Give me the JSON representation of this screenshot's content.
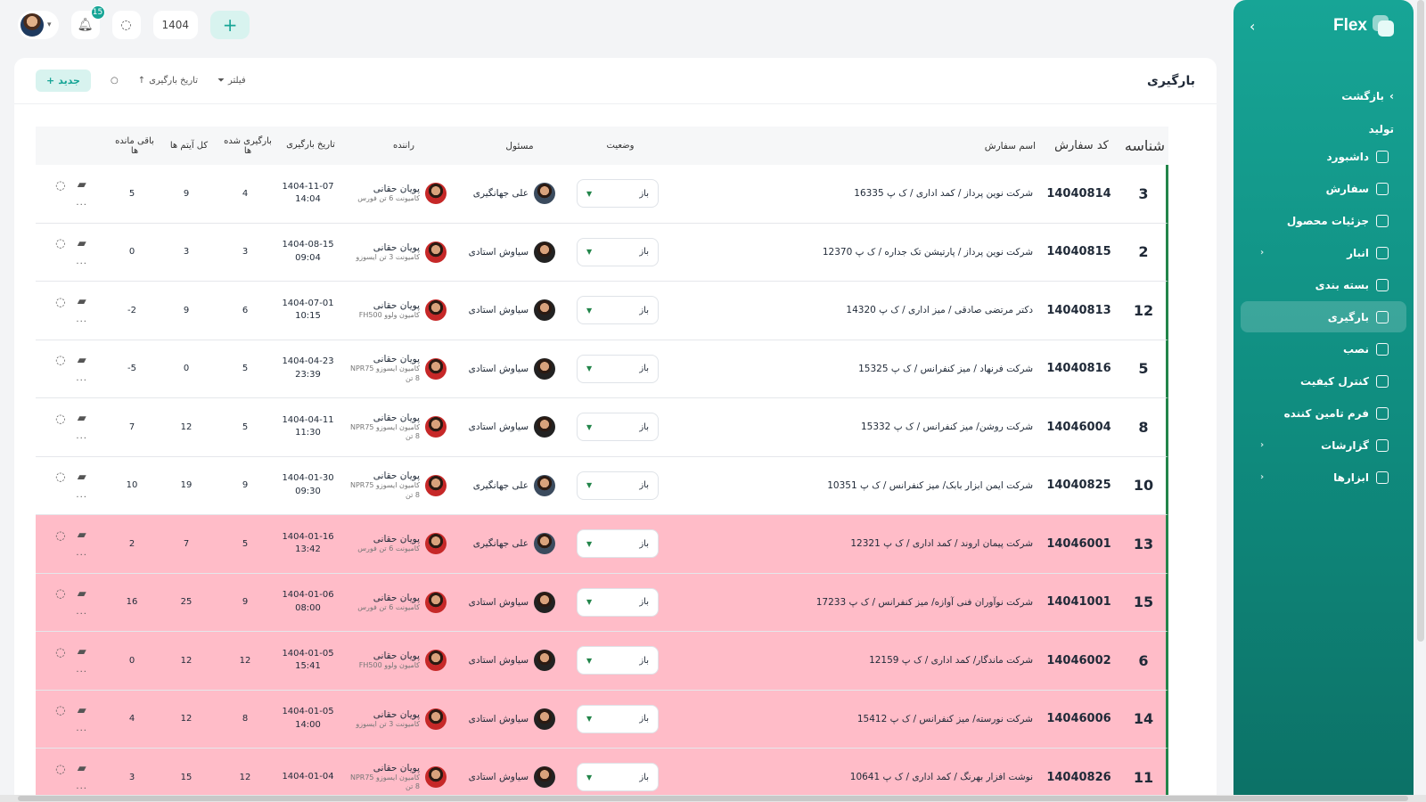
{
  "topbar": {
    "notif_count": "15",
    "year": "1404"
  },
  "sidebar": {
    "brand": "Flex",
    "back_label": "بازگشت",
    "section_label": "تولید",
    "items": [
      {
        "label": "داشبورد",
        "chevron": false,
        "active": false
      },
      {
        "label": "سفارش",
        "chevron": false,
        "active": false
      },
      {
        "label": "جزئیات محصول",
        "chevron": false,
        "active": false
      },
      {
        "label": "انبار",
        "chevron": true,
        "active": false
      },
      {
        "label": "بسته بندی",
        "chevron": false,
        "active": false
      },
      {
        "label": "بارگیری",
        "chevron": false,
        "active": true
      },
      {
        "label": "نصب",
        "chevron": false,
        "active": false
      },
      {
        "label": "کنترل کیفیت",
        "chevron": false,
        "active": false
      },
      {
        "label": "فرم تامین کننده",
        "chevron": false,
        "active": false
      },
      {
        "label": "گزارشات",
        "chevron": true,
        "active": false
      },
      {
        "label": "ابزارها",
        "chevron": true,
        "active": false
      }
    ]
  },
  "page": {
    "title": "بارگیری",
    "filter_label": "فیلتر",
    "sort_label": "تاریخ بارگیری",
    "new_label": "جدید"
  },
  "table": {
    "headers": {
      "id": "شناسه",
      "code": "کد سفارش",
      "name": "اسم سفارش",
      "status": "وضعیت",
      "responsible": "مسئول",
      "driver": "راننده",
      "date": "تاریخ بارگیری",
      "loaded": "بارگیری شده ها",
      "total": "کل آیتم ها",
      "remaining": "باقی مانده ها"
    },
    "rows": [
      {
        "id": "3",
        "code": "14040814",
        "name": "شرکت نوین پرداز / کمد اداری / ک پ 16335",
        "status": "باز",
        "responsible": "علی جهانگیری",
        "driver": "پویان حقانی",
        "vehicle": "کامیونت 6 تن فورس",
        "date": "1404-11-07",
        "time": "14:04",
        "loaded": "4",
        "total": "9",
        "remaining": "5",
        "pink": false
      },
      {
        "id": "2",
        "code": "14040815",
        "name": "شرکت نوین پرداز / پارتیشن تک جداره / ک پ 12370",
        "status": "باز",
        "responsible": "سیاوش استادی",
        "driver": "پویان حقانی",
        "vehicle": "کامیونت 3 تن ایسوزو",
        "date": "1404-08-15",
        "time": "09:04",
        "loaded": "3",
        "total": "3",
        "remaining": "0",
        "pink": false
      },
      {
        "id": "12",
        "code": "14040813",
        "name": "دکتر مرتضی صادقی / میز اداری / ک پ 14320",
        "status": "باز",
        "responsible": "سیاوش استادی",
        "driver": "پویان حقانی",
        "vehicle": "کامیون ولوو FH500",
        "date": "1404-07-01",
        "time": "10:15",
        "loaded": "6",
        "total": "9",
        "remaining": "2-",
        "pink": false
      },
      {
        "id": "5",
        "code": "14040816",
        "name": "شرکت فرنهاد / میز کنفرانس / ک پ 15325",
        "status": "باز",
        "responsible": "سیاوش استادی",
        "driver": "پویان حقانی",
        "vehicle": "کامیون ایسوزو NPR75 8 تن",
        "date": "1404-04-23",
        "time": "23:39",
        "loaded": "5",
        "total": "0",
        "remaining": "5-",
        "pink": false
      },
      {
        "id": "8",
        "code": "14046004",
        "name": "شرکت روشن/ میز کنفرانس / ک پ 15332",
        "status": "باز",
        "responsible": "سیاوش استادی",
        "driver": "پویان حقانی",
        "vehicle": "کامیون ایسوزو NPR75 8 تن",
        "date": "1404-04-11",
        "time": "11:30",
        "loaded": "5",
        "total": "12",
        "remaining": "7",
        "pink": false
      },
      {
        "id": "10",
        "code": "14040825",
        "name": "شرکت ایمن ابزار بابک/ میز کنفرانس / ک پ 10351",
        "status": "باز",
        "responsible": "علی جهانگیری",
        "driver": "پویان حقانی",
        "vehicle": "کامیون ایسوزو NPR75 8 تن",
        "date": "1404-01-30",
        "time": "09:30",
        "loaded": "9",
        "total": "19",
        "remaining": "10",
        "pink": false
      },
      {
        "id": "13",
        "code": "14046001",
        "name": "شرکت پیمان اروند / کمد اداری / ک پ 12321",
        "status": "باز",
        "responsible": "علی جهانگیری",
        "driver": "پویان حقانی",
        "vehicle": "کامیونت 6 تن فورس",
        "date": "1404-01-16",
        "time": "13:42",
        "loaded": "5",
        "total": "7",
        "remaining": "2",
        "pink": true
      },
      {
        "id": "15",
        "code": "14041001",
        "name": "شرکت نوآوران فنی آوازه/ میز کنفرانس / ک پ 17233",
        "status": "باز",
        "responsible": "سیاوش استادی",
        "driver": "پویان حقانی",
        "vehicle": "کامیونت 6 تن فورس",
        "date": "1404-01-06",
        "time": "08:00",
        "loaded": "9",
        "total": "25",
        "remaining": "16",
        "pink": true
      },
      {
        "id": "6",
        "code": "14046002",
        "name": "شرکت ماندگار/ کمد اداری / ک پ 12159",
        "status": "باز",
        "responsible": "سیاوش استادی",
        "driver": "پویان حقانی",
        "vehicle": "کامیون ولوو FH500",
        "date": "1404-01-05",
        "time": "15:41",
        "loaded": "12",
        "total": "12",
        "remaining": "0",
        "pink": true
      },
      {
        "id": "14",
        "code": "14046006",
        "name": "شرکت نورسته/ میز کنفرانس / ک پ 15412",
        "status": "باز",
        "responsible": "سیاوش استادی",
        "driver": "پویان حقانی",
        "vehicle": "کامیونت 3 تن ایسوزو",
        "date": "1404-01-05",
        "time": "14:00",
        "loaded": "8",
        "total": "12",
        "remaining": "4",
        "pink": true
      },
      {
        "id": "11",
        "code": "14040826",
        "name": "نوشت افزار بهرنگ / کمد اداری / ک پ 10641",
        "status": "باز",
        "responsible": "سیاوش استادی",
        "driver": "پویان حقانی",
        "vehicle": "کامیون ایسوزو NPR75 8 تن",
        "date": "1404-01-04",
        "time": "",
        "loaded": "12",
        "total": "15",
        "remaining": "3",
        "pink": true
      }
    ]
  }
}
